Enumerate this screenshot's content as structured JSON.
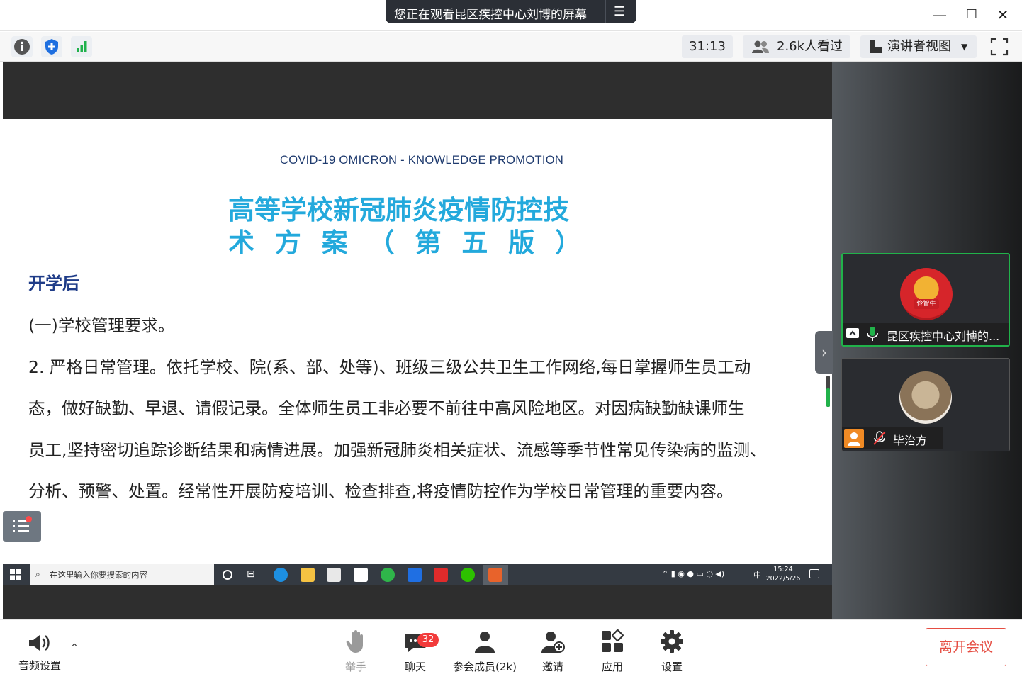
{
  "window": {
    "share_banner": "您正在观看昆区疾控中心刘博的屏幕",
    "minimize": "—",
    "maximize": "☐",
    "close": "✕"
  },
  "toolbar": {
    "timer": "31:13",
    "viewers": "2.6k人看过",
    "view_mode": "演讲者视图"
  },
  "slide": {
    "subtitle": "COVID-19 OMICRON - KNOWLEDGE PROMOTION",
    "title_line1": "高等学校新冠肺炎疫情防控技",
    "title_line2": "术 方 案 （ 第 五 版 ）",
    "heading": "开学后",
    "lines": [
      "(一)学校管理要求。",
      "2. 严格日常管理。依托学校、院(系、部、处等)、班级三级公共卫生工作网络,每日掌握师生员工动",
      "态，做好缺勤、早退、请假记录。全体师生员工非必要不前往中高风险地区。对因病缺勤缺课师生",
      "员工,坚持密切追踪诊断结果和病情进展。加强新冠肺炎相关症状、流感等季节性常见传染病的监测、",
      "分析、预警、处置。经常性开展防疫培训、检查排查,将疫情防控作为学校日常管理的重要内容。"
    ]
  },
  "taskbar": {
    "search_placeholder": "在这里输入你要搜索的内容",
    "time": "15:24",
    "date": "2022/5/26",
    "ime": "中"
  },
  "participants": [
    {
      "name": "昆区疾控中心刘博的...",
      "avatar_text": "伶智牛"
    },
    {
      "name": "毕治方"
    }
  ],
  "bottom": {
    "audio": "音频设置",
    "raise_hand": "举手",
    "chat": "聊天",
    "chat_badge": "32",
    "members": "参会成员(2k)",
    "invite": "邀请",
    "apps": "应用",
    "settings": "设置",
    "leave": "离开会议"
  },
  "colors": {
    "title_blue": "#23a9dc",
    "heading_navy": "#1f3c88",
    "leave_red": "#e54d42",
    "speaking_green": "#21b24a"
  }
}
